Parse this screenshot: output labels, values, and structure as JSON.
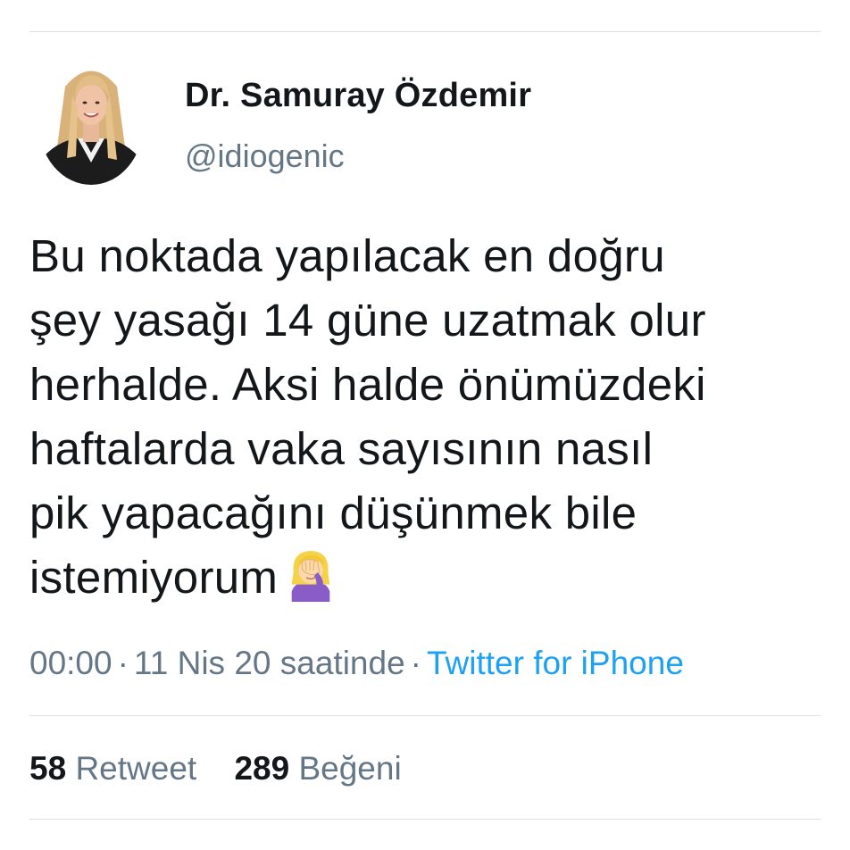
{
  "author": {
    "display_name": "Dr. Samuray Özdemir",
    "handle": "@idiogenic"
  },
  "tweet": {
    "lines": [
      "Bu noktada yapılacak en doğru",
      "şey yasağı 14 güne uzatmak olur",
      "herhalde. Aksi halde önümüzdeki",
      "haftalarda vaka sayısının nasıl",
      "pik yapacağını düşünmek bile",
      "istemiyorum"
    ],
    "emoji": "woman-facepalming-icon"
  },
  "meta": {
    "time": "00:00",
    "separator": "·",
    "date": "11 Nis 20 saatinde",
    "source": "Twitter for iPhone"
  },
  "stats": {
    "retweet_count": "58",
    "retweet_label": "Retweet",
    "like_count": "289",
    "like_label": "Beğeni"
  },
  "colors": {
    "text": "#14171a",
    "secondary": "#657786",
    "link": "#1da1f2",
    "divider": "#dbe0e4"
  }
}
